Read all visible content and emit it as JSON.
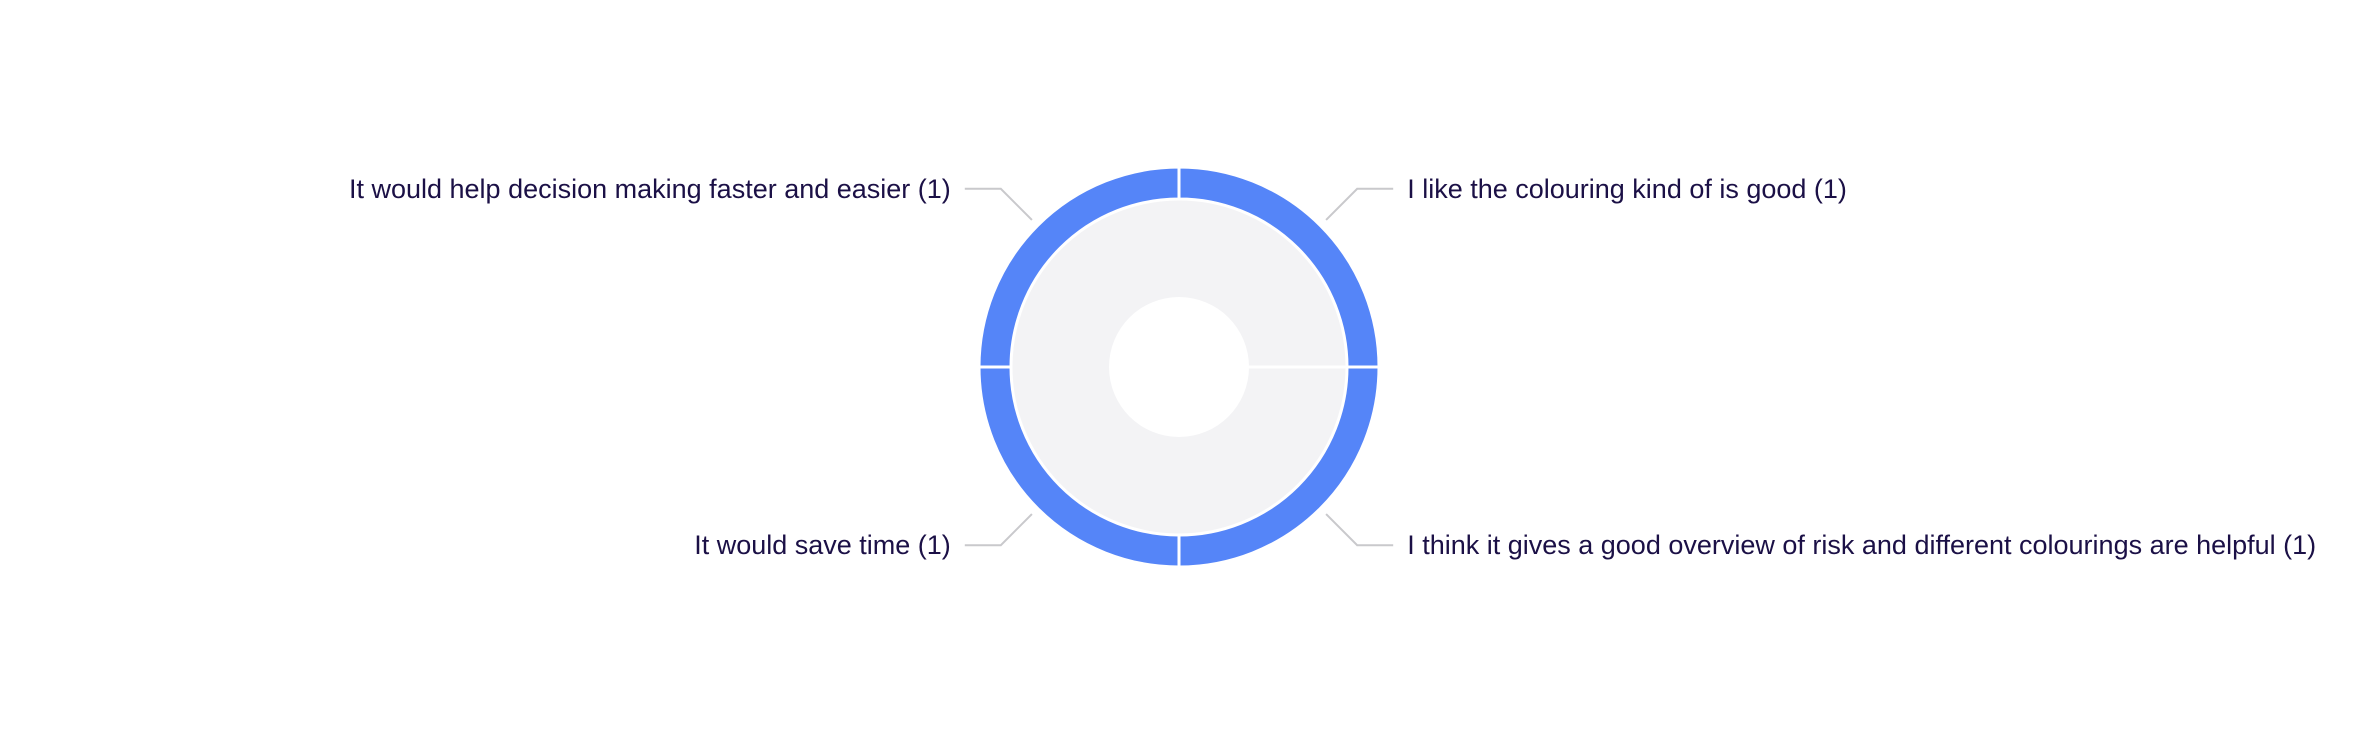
{
  "chart_data": {
    "type": "pie",
    "variant": "sunburst-donut",
    "title": "",
    "slices": [
      {
        "label": "I like the colouring kind of is good (1)",
        "value": 1
      },
      {
        "label": "I think it gives a good overview of risk and different colourings are helpful (1)",
        "value": 1
      },
      {
        "label": "It would save time (1)",
        "value": 1
      },
      {
        "label": "It would help decision making faster and easier (1)",
        "value": 1
      }
    ],
    "inner_ring": {
      "value": 4,
      "label": ""
    },
    "legend": "none",
    "colors": {
      "outer_ring": "#5585f8",
      "inner_ring": "#f3f3f5",
      "separator": "#ffffff",
      "label_text": "#1b1046",
      "leader_line": "#c9c9cc"
    }
  }
}
